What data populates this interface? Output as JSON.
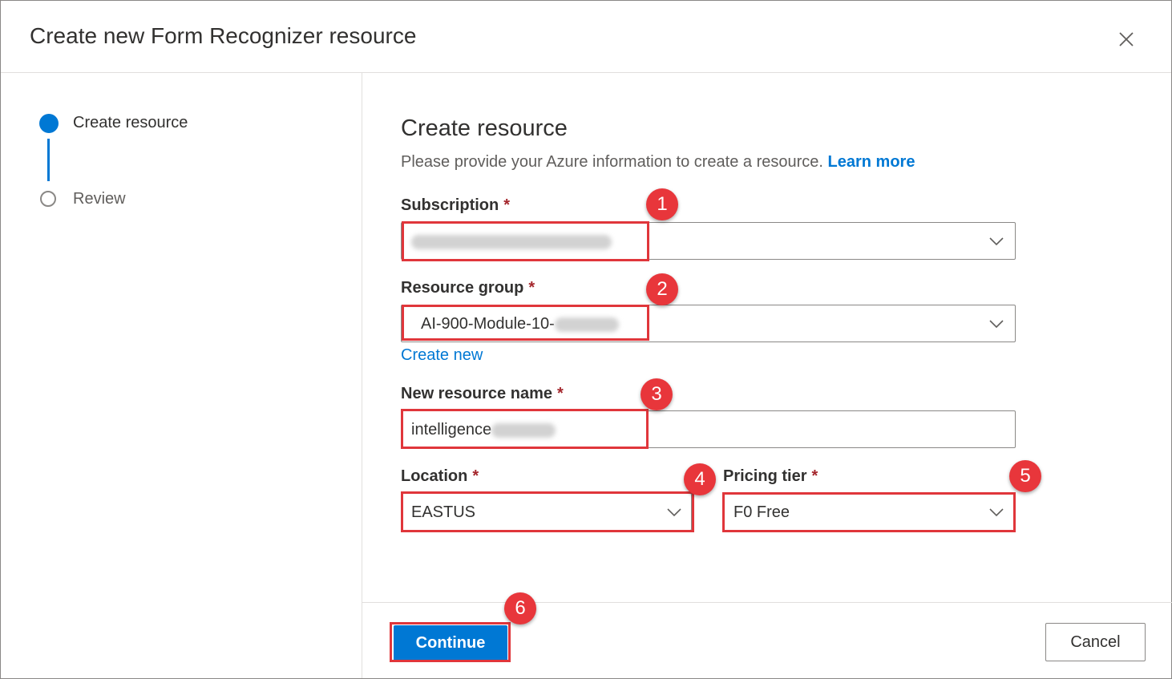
{
  "dialog": {
    "title": "Create new Form Recognizer resource",
    "close_icon": "close-icon"
  },
  "steps": [
    {
      "label": "Create resource",
      "state": "active"
    },
    {
      "label": "Review",
      "state": "inactive"
    }
  ],
  "form": {
    "title": "Create resource",
    "description": "Please provide your Azure information to create a resource.",
    "learn_more": "Learn more",
    "subscription": {
      "label": "Subscription",
      "required_mark": "*",
      "value": ""
    },
    "resource_group": {
      "label": "Resource group",
      "required_mark": "*",
      "value": "AI-900-Module-10-"
    },
    "create_new": "Create new",
    "resource_name": {
      "label": "New resource name",
      "required_mark": "*",
      "value": "intelligence"
    },
    "location": {
      "label": "Location",
      "required_mark": "*",
      "value": "EASTUS"
    },
    "pricing_tier": {
      "label": "Pricing tier",
      "required_mark": "*",
      "value": "F0 Free"
    }
  },
  "annotations": [
    "1",
    "2",
    "3",
    "4",
    "5",
    "6"
  ],
  "footer": {
    "continue_label": "Continue",
    "cancel_label": "Cancel"
  },
  "colors": {
    "accent": "#0078d4",
    "annotation_red": "#e0363b",
    "required_red": "#a4262c"
  }
}
